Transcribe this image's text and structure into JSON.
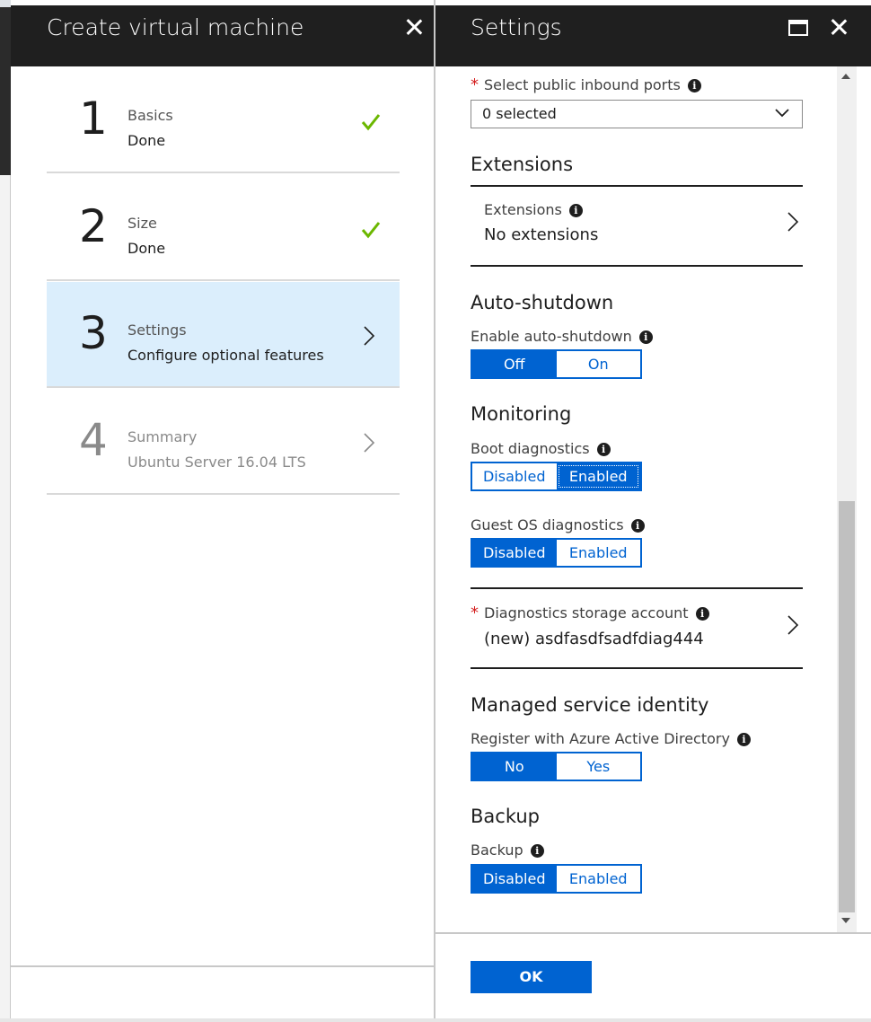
{
  "wizard": {
    "title": "Create virtual machine",
    "steps": [
      {
        "number": "1",
        "name": "Basics",
        "status": "Done"
      },
      {
        "number": "2",
        "name": "Size",
        "status": "Done"
      },
      {
        "number": "3",
        "name": "Settings",
        "status": "Configure optional features"
      },
      {
        "number": "4",
        "name": "Summary",
        "status": "Ubuntu Server 16.04 LTS"
      }
    ]
  },
  "settings": {
    "title": "Settings",
    "inbound_ports": {
      "label": "Select public inbound ports",
      "value": "0 selected"
    },
    "extensions": {
      "section": "Extensions",
      "label": "Extensions",
      "value": "No extensions"
    },
    "auto_shutdown": {
      "section": "Auto-shutdown",
      "label": "Enable auto-shutdown",
      "options": [
        "Off",
        "On"
      ],
      "selected": "Off"
    },
    "monitoring": {
      "section": "Monitoring",
      "boot": {
        "label": "Boot diagnostics",
        "options": [
          "Disabled",
          "Enabled"
        ],
        "selected": "Enabled"
      },
      "guest": {
        "label": "Guest OS diagnostics",
        "options": [
          "Disabled",
          "Enabled"
        ],
        "selected": "Disabled"
      },
      "storage": {
        "label": "Diagnostics storage account",
        "value": "(new) asdfasdfsadfdiag444"
      }
    },
    "msi": {
      "section": "Managed service identity",
      "label": "Register with Azure Active Directory",
      "options": [
        "No",
        "Yes"
      ],
      "selected": "No"
    },
    "backup": {
      "section": "Backup",
      "label": "Backup",
      "options": [
        "Disabled",
        "Enabled"
      ],
      "selected": "Disabled"
    },
    "ok_label": "OK"
  },
  "colors": {
    "accent": "#0063d1",
    "active_step": "#dbeefc",
    "check": "#6bb700",
    "required": "#d41e1e"
  }
}
